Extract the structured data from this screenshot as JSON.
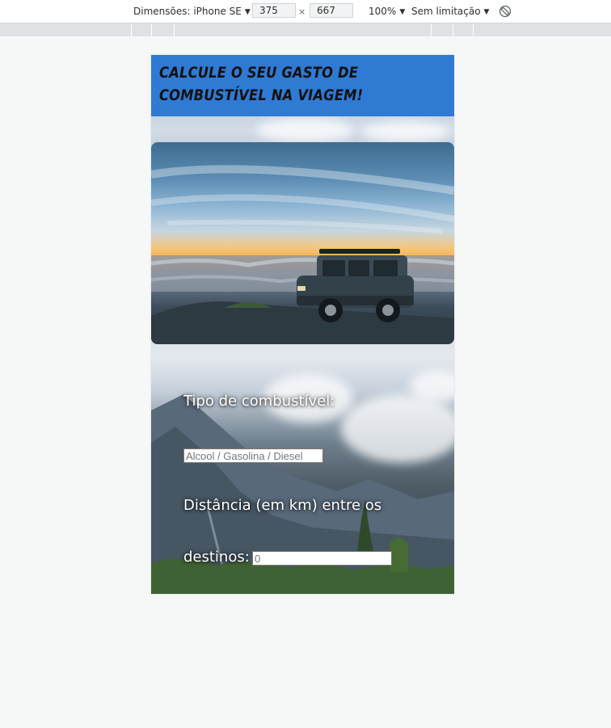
{
  "devtools": {
    "dimensions_label": "Dimensões: iPhone SE",
    "width_value": "375",
    "times_sign": "×",
    "height_value": "667",
    "zoom_label": "100%",
    "throttle_label": "Sem limitação",
    "rotate_icon": "rotate-icon",
    "dropdown_icon": "chevron-down-icon"
  },
  "page": {
    "title": "Calcule o seu gasto de combustível na viagem!",
    "header_color": "#2f7ad3",
    "hero_image": "car-on-cliff-sunset-image",
    "fuel": {
      "label": "Tipo de combustível:",
      "placeholder": "Alcool / Gasolina / Diesel",
      "value": ""
    },
    "distance": {
      "label_line1": "Distância (em km) entre os",
      "label_line2": "destinos:",
      "placeholder": "0",
      "value": ""
    }
  }
}
